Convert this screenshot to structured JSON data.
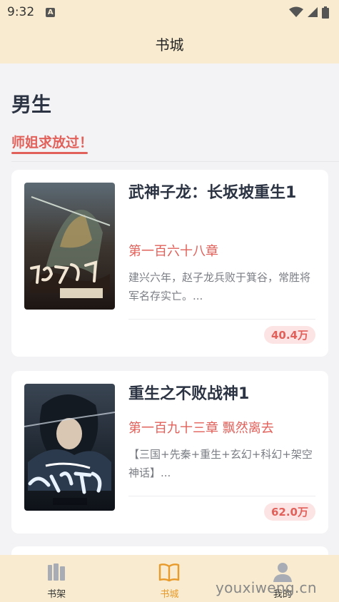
{
  "status_bar": {
    "time": "9:32",
    "app_icon": "A"
  },
  "header": {
    "title": "书城"
  },
  "section": {
    "title": "男生",
    "active_tab": "师姐求放过！"
  },
  "books": [
    {
      "cover_icon": "book-cover-image",
      "title": "武神子龙：长坂坡重生1",
      "chapter": "第一百六十八章",
      "description": "建兴六年，赵子龙兵败于箕谷，常胜将军名存实亡。...",
      "count": "40.4万"
    },
    {
      "cover_icon": "book-cover-image",
      "title": "重生之不败战神1",
      "chapter": "第一百九十三章 飘然离去",
      "description": "【三国+先秦+重生+玄幻+科幻+架空神话】...",
      "count": "62.0万"
    }
  ],
  "bottom_nav": [
    {
      "label": "书架",
      "icon": "bookshelf-icon"
    },
    {
      "label": "书城",
      "icon": "open-book-icon",
      "active": true
    },
    {
      "label": "我的",
      "icon": "person-icon"
    }
  ],
  "watermark": "youxiweng.cn",
  "colors": {
    "accent": "#e2605a",
    "header_bg": "#f8ebcf",
    "nav_active": "#e89a2a"
  }
}
